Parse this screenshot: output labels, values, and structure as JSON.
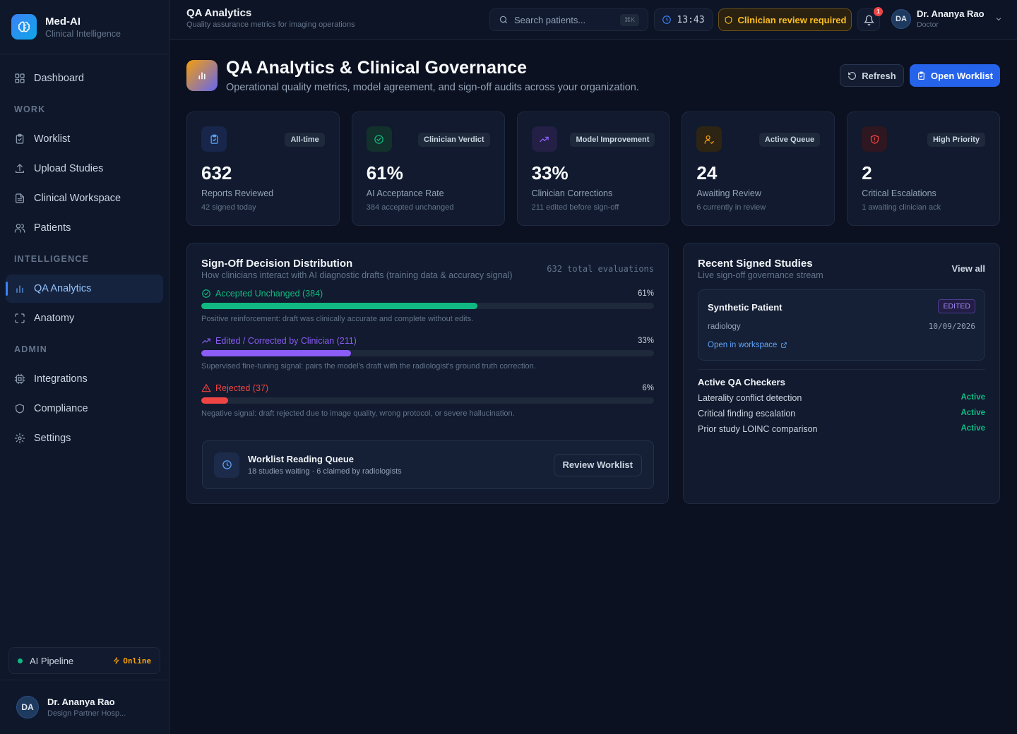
{
  "brand": {
    "name": "Med-AI",
    "subtitle": "Clinical Intelligence"
  },
  "sidebar": {
    "dashboard": "Dashboard",
    "sections": {
      "work": "WORK",
      "intelligence": "INTELLIGENCE",
      "admin": "ADMIN"
    },
    "work_items": [
      "Worklist",
      "Upload Studies",
      "Clinical Workspace",
      "Patients"
    ],
    "intelligence_items": [
      "QA Analytics",
      "Anatomy"
    ],
    "admin_items": [
      "Integrations",
      "Compliance",
      "Settings"
    ],
    "active_item": "QA Analytics",
    "pipeline": {
      "label": "AI Pipeline",
      "status": "Online",
      "status_color": "#f59e0b"
    },
    "user": {
      "initials": "DA",
      "name": "Dr. Ananya Rao",
      "org": "Design Partner Hosp..."
    }
  },
  "topbar": {
    "title": "QA Analytics",
    "subtitle": "Quality assurance metrics for imaging operations",
    "search_placeholder": "Search patients...",
    "search_shortcut": "⌘K",
    "time": "13:43",
    "review_badge": "Clinician review required",
    "notifications": "1",
    "user": {
      "initials": "DA",
      "name": "Dr. Ananya Rao",
      "role": "Doctor"
    }
  },
  "page": {
    "title": "QA Analytics & Clinical Governance",
    "subtitle": "Operational quality metrics, model agreement, and sign-off audits across your organization.",
    "refresh_label": "Refresh",
    "worklist_label": "Open Worklist"
  },
  "stats": [
    {
      "tag": "All-time",
      "value": "632",
      "label": "Reports Reviewed",
      "note": "42 signed today",
      "icon": "clipboard-icon",
      "color": "#60a5fa",
      "bg": "#17264a"
    },
    {
      "tag": "Clinician Verdict",
      "value": "61%",
      "label": "AI Acceptance Rate",
      "note": "384 accepted unchanged",
      "icon": "check-circle-icon",
      "color": "#10b981",
      "bg": "#12302c"
    },
    {
      "tag": "Model Improvement",
      "value": "33%",
      "label": "Clinician Corrections",
      "note": "211 edited before sign-off",
      "icon": "trending-up-icon",
      "color": "#8b5cf6",
      "bg": "#231f45"
    },
    {
      "tag": "Active Queue",
      "value": "24",
      "label": "Awaiting Review",
      "note": "6 currently in review",
      "icon": "user-check-icon",
      "color": "#f59e0b",
      "bg": "#2e2414"
    },
    {
      "tag": "High Priority",
      "value": "2",
      "label": "Critical Escalations",
      "note": "1 awaiting clinician ack",
      "icon": "shield-alert-icon",
      "color": "#ef4444",
      "bg": "#2e1720"
    }
  ],
  "distribution": {
    "title": "Sign-Off Decision Distribution",
    "subtitle": "How clinicians interact with AI diagnostic drafts (training data & accuracy signal)",
    "total": "632 total evaluations",
    "bars": [
      {
        "label": "Accepted Unchanged (384)",
        "pct_label": "61%",
        "fraction": 0.61,
        "color": "#10b981",
        "note": "Positive reinforcement: draft was clinically accurate and complete without edits.",
        "icon": "check-circle-icon"
      },
      {
        "label": "Edited / Corrected by Clinician (211)",
        "pct_label": "33%",
        "fraction": 0.33,
        "color": "#8b5cf6",
        "note": "Supervised fine-tuning signal: pairs the model's draft with the radiologist's ground truth correction.",
        "icon": "trending-up-icon"
      },
      {
        "label": "Rejected (37)",
        "pct_label": "6%",
        "fraction": 0.06,
        "color": "#ef4444",
        "note": "Negative signal: draft rejected due to image quality, wrong protocol, or severe hallucination.",
        "icon": "alert-triangle-icon"
      }
    ],
    "queue": {
      "title": "Worklist Reading Queue",
      "subtitle": "18 studies waiting · 6 claimed by radiologists",
      "button": "Review Worklist"
    }
  },
  "recent": {
    "title": "Recent Signed Studies",
    "subtitle": "Live sign-off governance stream",
    "view_all": "View all",
    "study": {
      "patient": "Synthetic Patient",
      "badge": "EDITED",
      "modality": "radiology",
      "date": "10/09/2026",
      "link": "Open in workspace"
    },
    "checkers_title": "Active QA Checkers",
    "checkers": [
      {
        "name": "Laterality conflict detection",
        "status": "Active"
      },
      {
        "name": "Critical finding escalation",
        "status": "Active"
      },
      {
        "name": "Prior study LOINC comparison",
        "status": "Active"
      }
    ]
  }
}
